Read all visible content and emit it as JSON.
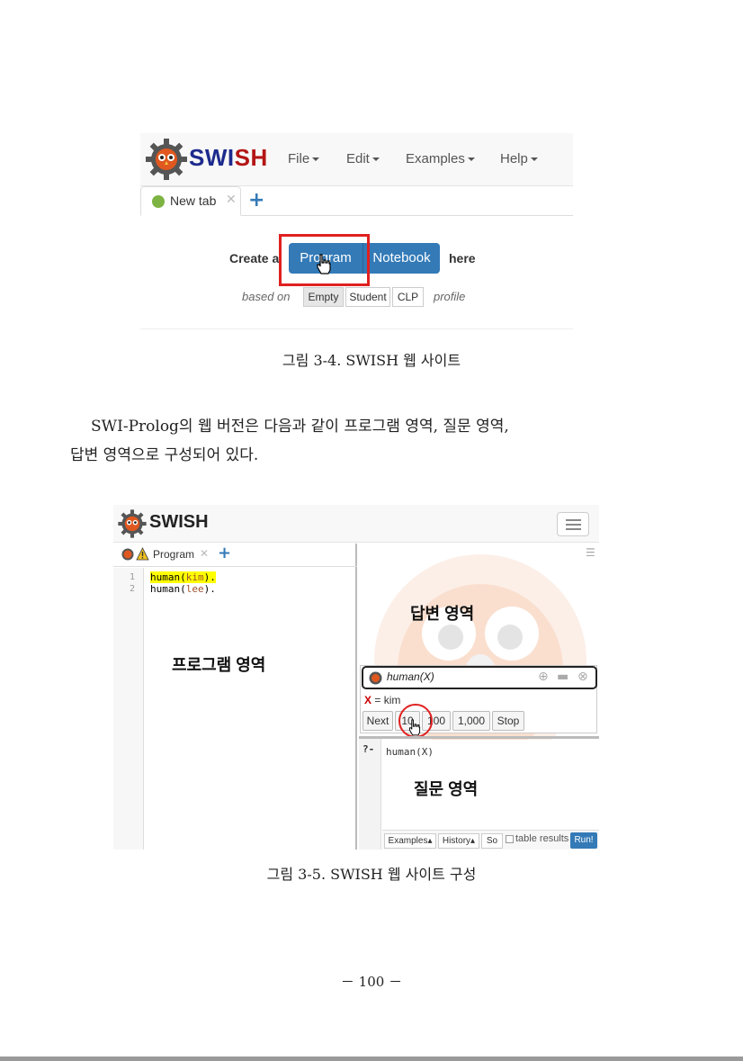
{
  "figure1": {
    "brand_part1": "SWI",
    "brand_part2": "SH",
    "menus": [
      "File",
      "Edit",
      "Examples",
      "Help"
    ],
    "tab_label": "New tab",
    "tab_close": "✕",
    "tab_add": "+",
    "create_prefix": "Create a",
    "program_button": "Program",
    "notebook_button": "Notebook",
    "create_suffix": "here",
    "based_on": "based on",
    "profiles": [
      "Empty",
      "Student",
      "CLP"
    ],
    "profile_suffix": "profile",
    "colors": {
      "accent": "#337ab7",
      "highlight": "#e02020",
      "brand_blue": "#1d2b8d",
      "brand_red": "#b31515"
    }
  },
  "caption1": "그림 3-4. SWISH 웹 사이트",
  "paragraph": {
    "line1": "SWI-Prolog의 웹 버전은 다음과 같이 프로그램 영역, 질문 영역,",
    "line2": "답변 영역으로 구성되어 있다."
  },
  "figure2": {
    "brand_part1": "SWI",
    "brand_part2": "SH",
    "program_tab": "Program",
    "tab_close": "✕",
    "tab_add": "+",
    "code_lines": [
      {
        "no": "1",
        "pred": "human",
        "arg": "kim",
        "end": ")."
      },
      {
        "no": "2",
        "pred": "human",
        "arg": "lee",
        "end": ")."
      }
    ],
    "label_program_area": "프로그램 영역",
    "label_answer_area": "답변 영역",
    "label_query_area": "질문 영역",
    "query_head": "human(X)",
    "answer_var": "X",
    "answer_rest": " = kim",
    "buttons": [
      "Next",
      "10",
      "100",
      "1,000",
      "Stop"
    ],
    "prompt": "?-",
    "query_code": "human(X)",
    "bottom_buttons": [
      "Examples▴",
      "History▴",
      "So"
    ],
    "table_results": "table results",
    "run_button": "Run!"
  },
  "caption2": "그림 3-5. SWISH 웹 사이트 구성",
  "page_number": "－ 100 －"
}
